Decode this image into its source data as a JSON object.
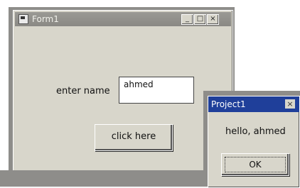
{
  "form": {
    "title": "Form1",
    "controls": {
      "minimize": "_",
      "maximize": "□",
      "close": "×"
    },
    "name_label": "enter name",
    "name_value": "ahmed",
    "button_label": "click here"
  },
  "messagebox": {
    "title": "Project1",
    "close": "×",
    "message": "hello, ahmed",
    "ok_label": "OK"
  }
}
